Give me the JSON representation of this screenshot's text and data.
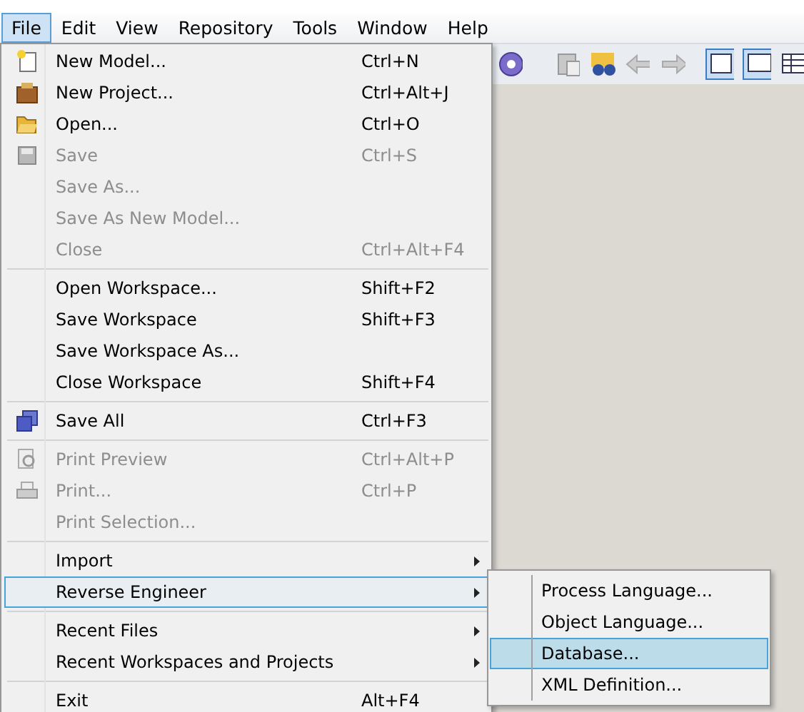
{
  "menu_bar": [
    {
      "label": "File",
      "selected": true
    },
    {
      "label": "Edit",
      "selected": false
    },
    {
      "label": "View",
      "selected": false
    },
    {
      "label": "Repository",
      "selected": false
    },
    {
      "label": "Tools",
      "selected": false
    },
    {
      "label": "Window",
      "selected": false
    },
    {
      "label": "Help",
      "selected": false
    }
  ],
  "file_menu": [
    {
      "kind": "item",
      "label": "New Model...",
      "shortcut": "Ctrl+N",
      "disabled": false,
      "selected": false,
      "has_submenu": false
    },
    {
      "kind": "item",
      "label": "New Project...",
      "shortcut": "Ctrl+Alt+J",
      "disabled": false,
      "selected": false,
      "has_submenu": false
    },
    {
      "kind": "item",
      "label": "Open...",
      "shortcut": "Ctrl+O",
      "disabled": false,
      "selected": false,
      "has_submenu": false
    },
    {
      "kind": "item",
      "label": "Save",
      "shortcut": "Ctrl+S",
      "disabled": true,
      "selected": false,
      "has_submenu": false
    },
    {
      "kind": "item",
      "label": "Save As...",
      "disabled": true,
      "selected": false,
      "has_submenu": false
    },
    {
      "kind": "item",
      "label": "Save As New Model...",
      "disabled": true,
      "selected": false,
      "has_submenu": false
    },
    {
      "kind": "item",
      "label": "Close",
      "shortcut": "Ctrl+Alt+F4",
      "disabled": true,
      "selected": false,
      "has_submenu": false
    },
    {
      "kind": "separator"
    },
    {
      "kind": "item",
      "label": "Open Workspace...",
      "shortcut": "Shift+F2",
      "disabled": false,
      "selected": false,
      "has_submenu": false
    },
    {
      "kind": "item",
      "label": "Save Workspace",
      "shortcut": "Shift+F3",
      "disabled": false,
      "selected": false,
      "has_submenu": false
    },
    {
      "kind": "item",
      "label": "Save Workspace As...",
      "disabled": false,
      "selected": false,
      "has_submenu": false
    },
    {
      "kind": "item",
      "label": "Close Workspace",
      "shortcut": "Shift+F4",
      "disabled": false,
      "selected": false,
      "has_submenu": false
    },
    {
      "kind": "separator"
    },
    {
      "kind": "item",
      "label": "Save All",
      "shortcut": "Ctrl+F3",
      "disabled": false,
      "selected": false,
      "has_submenu": false
    },
    {
      "kind": "separator"
    },
    {
      "kind": "item",
      "label": "Print Preview",
      "shortcut": "Ctrl+Alt+P",
      "disabled": true,
      "selected": false,
      "has_submenu": false
    },
    {
      "kind": "item",
      "label": "Print...",
      "shortcut": "Ctrl+P",
      "disabled": true,
      "selected": false,
      "has_submenu": false
    },
    {
      "kind": "item",
      "label": "Print Selection...",
      "disabled": true,
      "selected": false,
      "has_submenu": false
    },
    {
      "kind": "separator"
    },
    {
      "kind": "item",
      "label": "Import",
      "disabled": false,
      "selected": false,
      "has_submenu": true
    },
    {
      "kind": "item",
      "label": "Reverse Engineer",
      "disabled": false,
      "selected": true,
      "has_submenu": true
    },
    {
      "kind": "separator"
    },
    {
      "kind": "item",
      "label": "Recent Files",
      "disabled": false,
      "selected": false,
      "has_submenu": true
    },
    {
      "kind": "item",
      "label": "Recent Workspaces and Projects",
      "disabled": false,
      "selected": false,
      "has_submenu": true
    },
    {
      "kind": "separator"
    },
    {
      "kind": "item",
      "label": "Exit",
      "shortcut": "Alt+F4",
      "disabled": false,
      "selected": false,
      "has_submenu": false
    }
  ],
  "reverse_engineer_submenu": [
    {
      "label": "Process Language...",
      "selected": false
    },
    {
      "label": "Object Language...",
      "selected": false
    },
    {
      "label": "Database...",
      "selected": true
    },
    {
      "label": "XML Definition...",
      "selected": false
    }
  ]
}
